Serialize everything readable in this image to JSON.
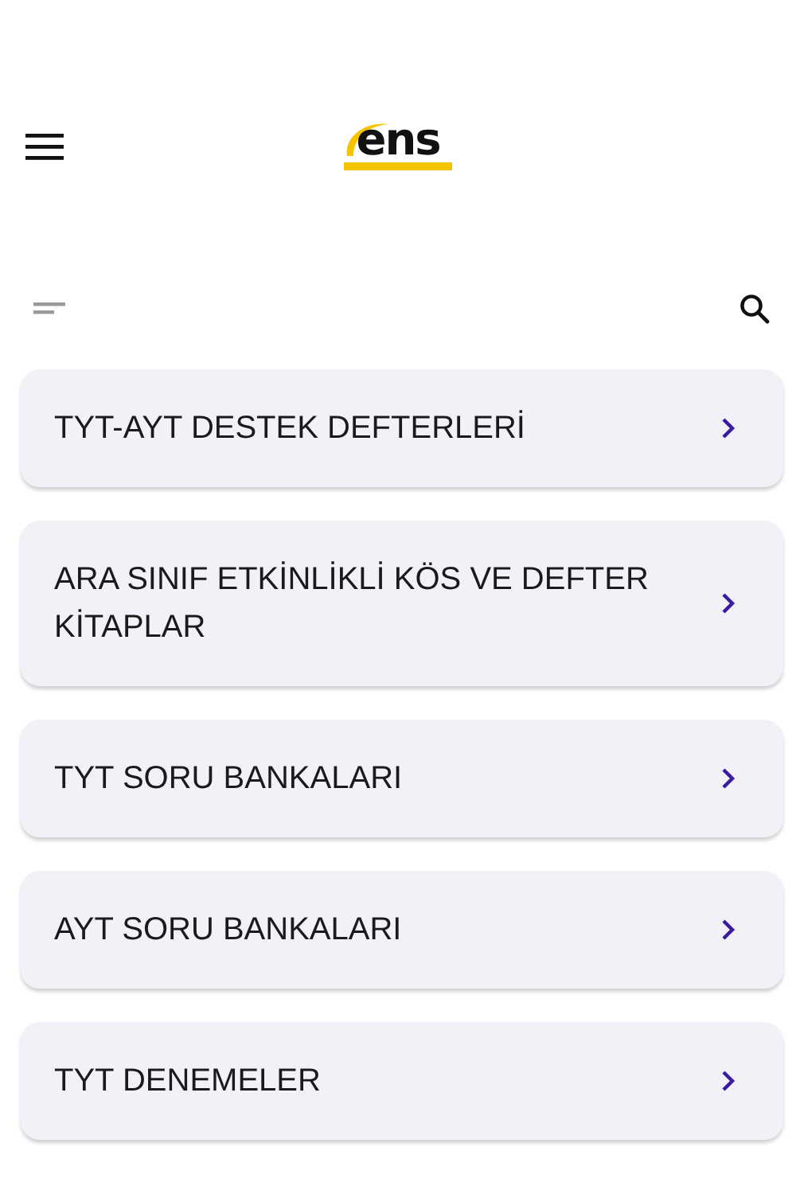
{
  "header": {
    "logo": {
      "text": "ens"
    }
  },
  "categories": [
    {
      "label": "TYT-AYT DESTEK DEFTERLERİ"
    },
    {
      "label": "ARA SINIF ETKİNLİKLİ KÖS VE DEFTER KİTAPLAR"
    },
    {
      "label": "TYT SORU BANKALARI"
    },
    {
      "label": "AYT SORU BANKALARI"
    },
    {
      "label": "TYT DENEMELER"
    }
  ]
}
